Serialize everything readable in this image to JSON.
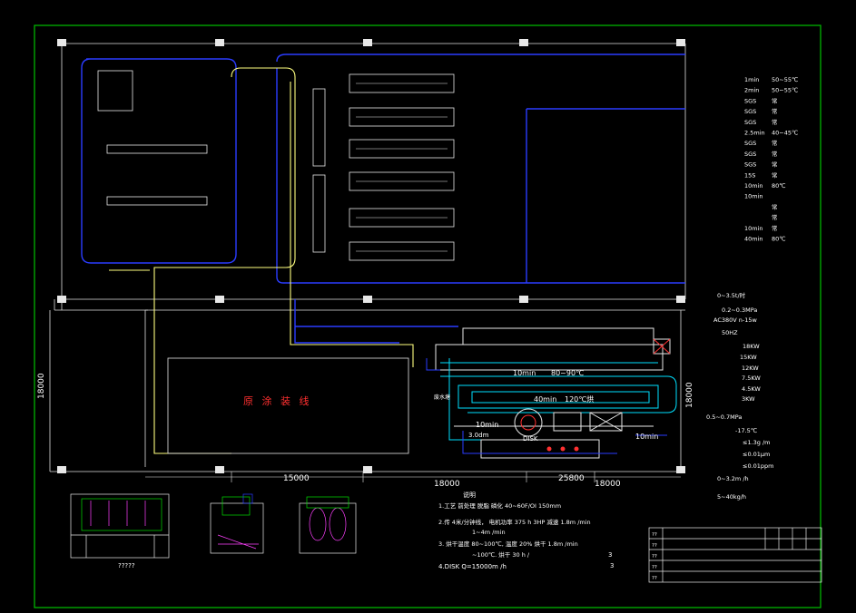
{
  "colors": {
    "background": "#000000",
    "frame": "#00c000",
    "pipe_blue": "#2a3cff",
    "pipe_yellow": "#ffff80",
    "pipe_cyan": "#00e0ff",
    "line_white": "#e8e8e8",
    "label_red": "#ff3030",
    "label_magenta": "#ff40ff"
  },
  "plan": {
    "main_line_label": "原 涂 装 线",
    "oven_segments": [
      {
        "time": "10min",
        "temp": "80~90℃"
      },
      {
        "time": "40min",
        "temp": "120℃烘"
      }
    ],
    "cooling_label": "10min",
    "cooling_label_2": "10min",
    "dip_label": "3.0dm",
    "tank_label": "废水塘",
    "disk_label": "DISK"
  },
  "dimensions": {
    "left_height": "18000",
    "right_height": "18000",
    "bottom_1": "15000",
    "bottom_2": "18000",
    "bottom_3": "25800",
    "bottom_4": "18000"
  },
  "process_table": [
    {
      "time": "1min",
      "temp": "50~55℃"
    },
    {
      "time": "2min",
      "temp": "50~55℃"
    },
    {
      "time": "SGS",
      "temp": "常"
    },
    {
      "time": "SGS",
      "temp": "常"
    },
    {
      "time": "SGS",
      "temp": "常"
    },
    {
      "time": "2.5min",
      "temp": "40~45℃"
    },
    {
      "time": "SGS",
      "temp": "常"
    },
    {
      "time": "SGS",
      "temp": "常"
    },
    {
      "time": "SGS",
      "temp": "常"
    },
    {
      "time": "15S",
      "temp": "常"
    },
    {
      "time": "10min",
      "temp": "80℃"
    },
    {
      "time": "10min",
      "temp": ""
    },
    {
      "time": "",
      "temp": "常"
    },
    {
      "time": "",
      "temp": "常"
    },
    {
      "time": "10min",
      "temp": "常"
    },
    {
      "time": "40min",
      "temp": "80℃"
    }
  ],
  "specs": [
    "0~3.5t/时",
    "0.2~0.3MPa",
    "AC380V n-15w",
    "50HZ",
    "18KW",
    "15KW",
    "12KW",
    "7.5KW",
    "4.5KW",
    "3KW",
    "0.5~0.7MPa",
    "-17.5℃",
    "≤1.3g /m",
    "≤0.01μm",
    "≤0.01ppm",
    "0~3.2m /h",
    "5~40kg/h"
  ],
  "notes": {
    "heading": "说明",
    "items": [
      "1.工艺  前处理 脱脂 磷化 40~60F/OI 150mm",
      "2.传 4米/分钟线，  电机功率 375 h 3HP 减速  1.8m /min",
      "3. 烘干温度 80~100℃, 温度 20%  烘干  1.8m /min",
      "  ~100℃. 烘干 30 h /  ",
      "4.DISK  Q=15000m  /h  "
    ],
    "note_3_value": "3",
    "note_4_value": "3",
    "line_speed": "1~4m /min"
  },
  "detail_views": {
    "view1_caption": "?????",
    "view2_caption": "",
    "view3_caption": ""
  },
  "title_block": {
    "rows": [
      "??",
      "??",
      "??",
      "??",
      "??"
    ],
    "header": [
      "??",
      "",
      "",
      ""
    ]
  }
}
